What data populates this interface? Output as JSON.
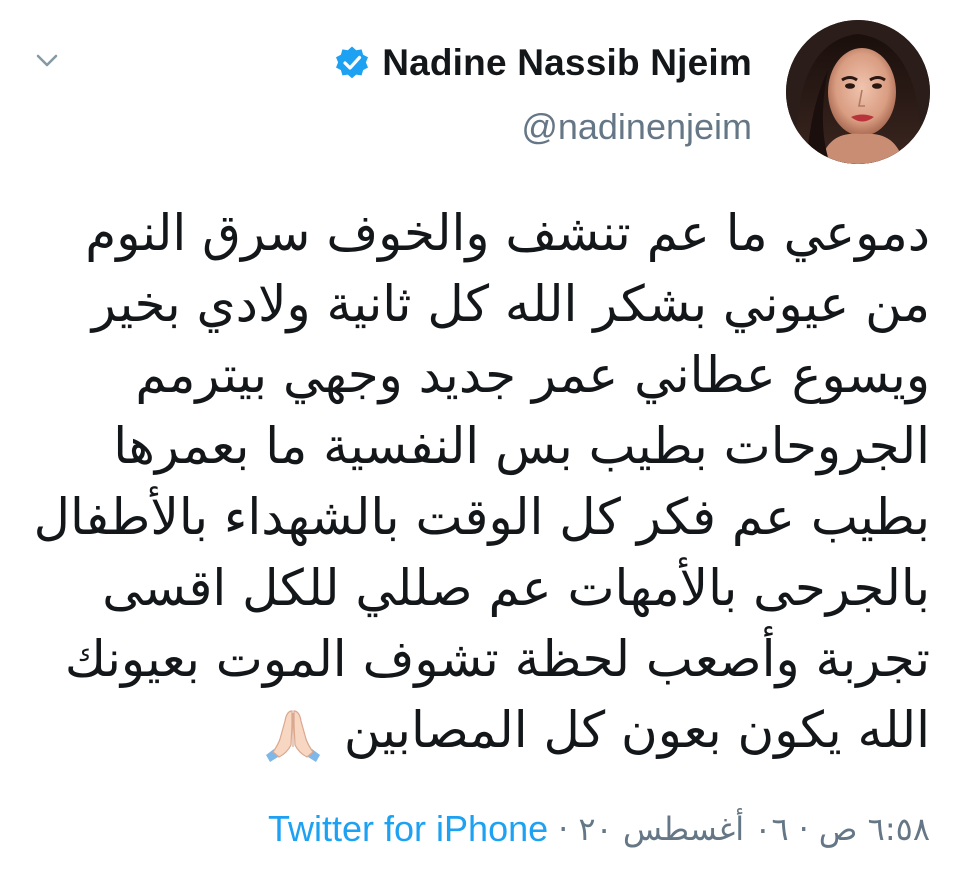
{
  "tweet": {
    "author": {
      "display_name": "Nadine Nassib Njeim",
      "handle": "@nadinenjeim",
      "verified": true,
      "avatar": "profile-photo"
    },
    "text_lines": [
      "دموعي ما عم تنشف والخوف سرق النوم",
      "من عيوني بشكر الله كل ثانية ولادي بخير",
      "ويسوع عطاني عمر جديد وجهي بيترمم",
      "الجروحات بطيب بس النفسية ما بعمرها",
      "بطيب عم فكر كل الوقت بالشهداء بالأطفال",
      "بالجرحى بالأمهات عم صللي للكل اقسى",
      "تجربة وأصعب لحظة تشوف الموت بعيونك",
      "الله يكون بعون كل المصابين"
    ],
    "emoji": "folded-hands",
    "time": "٦:٥٨ ص",
    "date": "٠٦ أغسطس ٢٠",
    "source": "Twitter for iPhone"
  },
  "icons": {
    "chevron": "chevron-down-icon",
    "verified": "verified-badge-icon"
  },
  "colors": {
    "text": "#14171a",
    "secondary": "#657786",
    "link": "#1da1f2",
    "verified": "#1da1f2"
  }
}
